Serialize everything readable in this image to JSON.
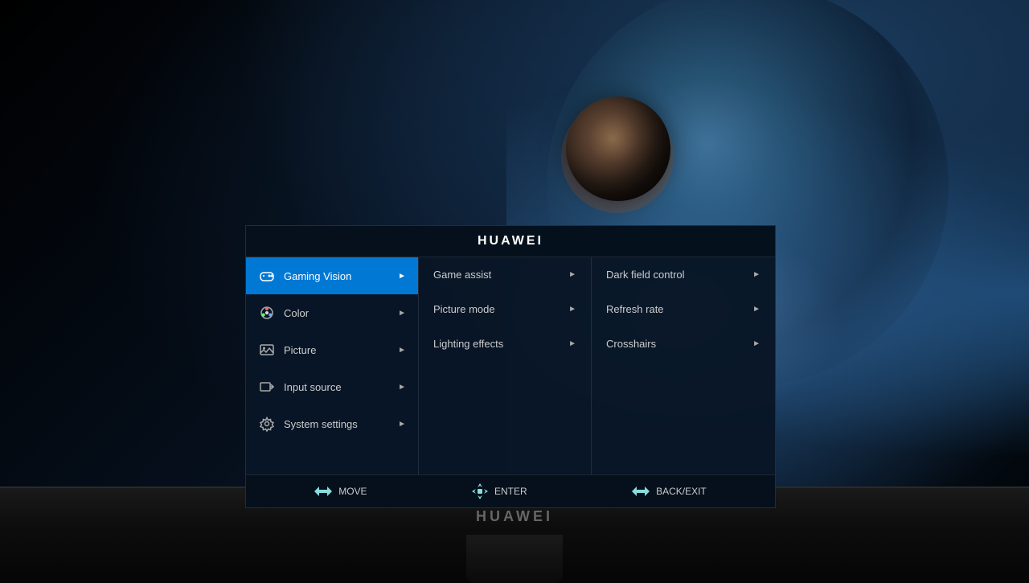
{
  "background": {
    "brand": "HUAWEI"
  },
  "osd": {
    "title": "HUAWEI",
    "menu_items": [
      {
        "id": "gaming-vision",
        "label": "Gaming Vision",
        "icon": "gamepad",
        "active": true,
        "has_arrow": true
      },
      {
        "id": "color",
        "label": "Color",
        "icon": "color-wheel",
        "active": false,
        "has_arrow": true
      },
      {
        "id": "picture",
        "label": "Picture",
        "icon": "picture",
        "active": false,
        "has_arrow": true
      },
      {
        "id": "input-source",
        "label": "Input source",
        "icon": "input",
        "active": false,
        "has_arrow": true
      },
      {
        "id": "system-settings",
        "label": "System settings",
        "icon": "gear",
        "active": false,
        "has_arrow": true
      }
    ],
    "sub_items": [
      {
        "id": "game-assist",
        "label": "Game assist",
        "has_arrow": true
      },
      {
        "id": "picture-mode",
        "label": "Picture mode",
        "has_arrow": true
      },
      {
        "id": "lighting-effects",
        "label": "Lighting effects",
        "has_arrow": true
      }
    ],
    "right_items": [
      {
        "id": "dark-field-control",
        "label": "Dark field control",
        "has_arrow": true
      },
      {
        "id": "refresh-rate",
        "label": "Refresh rate",
        "has_arrow": true
      },
      {
        "id": "crosshairs",
        "label": "Crosshairs",
        "has_arrow": true
      }
    ],
    "footer": [
      {
        "id": "move",
        "label": "MOVE",
        "icon": "dpad-horizontal"
      },
      {
        "id": "enter",
        "label": "ENTER",
        "icon": "dpad-all"
      },
      {
        "id": "back-exit",
        "label": "BACK/EXIT",
        "icon": "dpad-back"
      }
    ]
  }
}
